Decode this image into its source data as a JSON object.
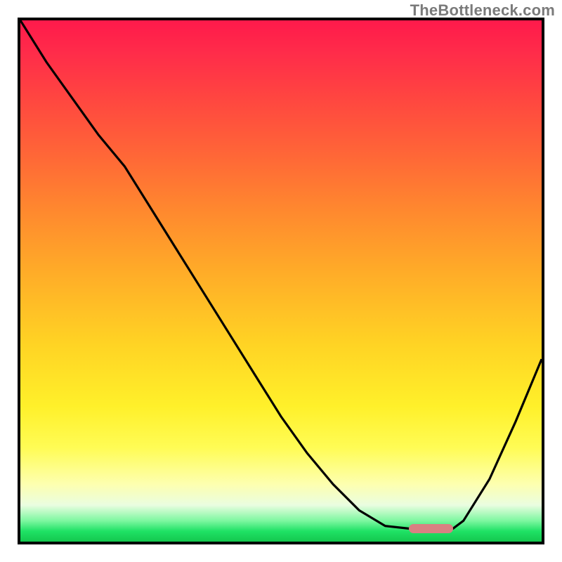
{
  "watermark": "TheBottleneck.com",
  "colors": {
    "border": "#000000",
    "curve": "#000000",
    "marker": "#d98082",
    "gradient_top": "#ff1a4b",
    "gradient_bottom": "#14c74e"
  },
  "plot": {
    "inner_width": 742,
    "inner_height": 742
  },
  "marker": {
    "x_frac": 0.745,
    "y_frac": 0.975,
    "w_frac": 0.085,
    "h_frac": 0.018
  },
  "chart_data": {
    "type": "line",
    "title": "",
    "xlabel": "",
    "ylabel": "",
    "xlim": [
      0,
      1
    ],
    "ylim": [
      0,
      1
    ],
    "grid": false,
    "x": [
      0.0,
      0.05,
      0.1,
      0.15,
      0.2,
      0.25,
      0.3,
      0.35,
      0.4,
      0.45,
      0.5,
      0.55,
      0.6,
      0.65,
      0.7,
      0.745,
      0.79,
      0.83,
      0.85,
      0.9,
      0.95,
      1.0
    ],
    "values": [
      1.0,
      0.92,
      0.85,
      0.78,
      0.72,
      0.64,
      0.56,
      0.48,
      0.4,
      0.32,
      0.24,
      0.17,
      0.11,
      0.06,
      0.03,
      0.025,
      0.025,
      0.025,
      0.04,
      0.12,
      0.23,
      0.35
    ],
    "note": "Normalized curve estimated from pixels; V-shaped bottleneck curve with minimum plateau around x≈0.75–0.83.",
    "marker_region": {
      "x_start": 0.745,
      "x_end": 0.83,
      "y": 0.025
    }
  }
}
